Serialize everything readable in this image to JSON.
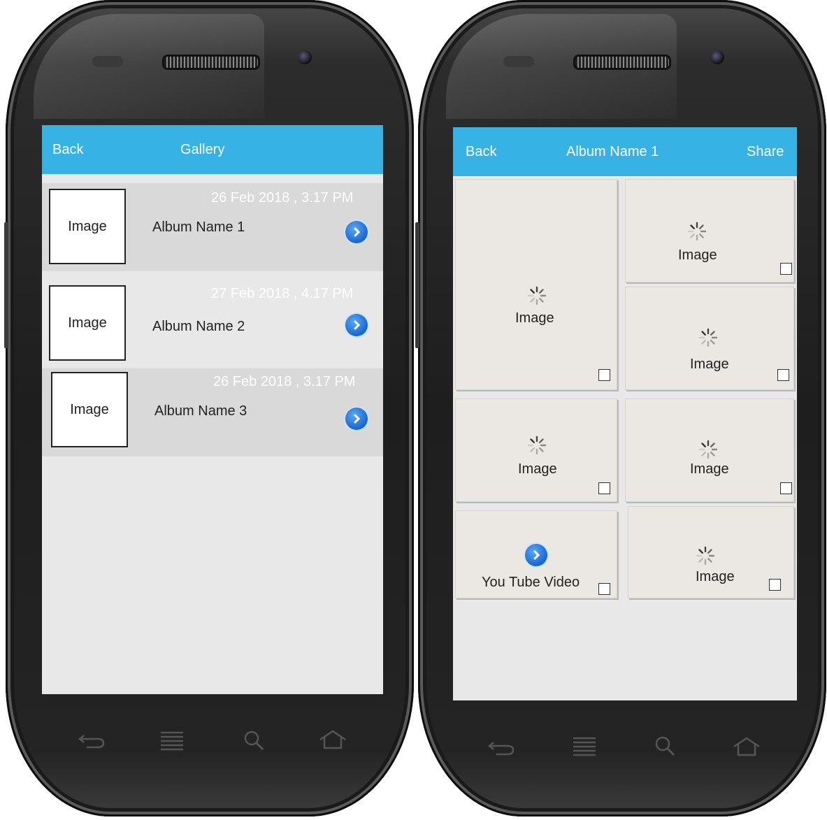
{
  "left_screen": {
    "header": {
      "back_label": "Back",
      "title": "Gallery"
    },
    "albums": [
      {
        "thumb_label": "Image",
        "date": "26 Feb 2018 ,  3.17 PM",
        "name": "Album Name  1"
      },
      {
        "thumb_label": "Image",
        "date": "27 Feb 2018 ,  4.17 PM",
        "name": "Album Name  2"
      },
      {
        "thumb_label": "Image",
        "date": "26 Feb 2018 ,  3.17 PM",
        "name": "Album Name  3"
      }
    ]
  },
  "right_screen": {
    "header": {
      "back_label": "Back",
      "title": "Album  Name 1",
      "share_label": "Share"
    },
    "tiles": [
      {
        "label": "Image"
      },
      {
        "label": "Image"
      },
      {
        "label": "Image"
      },
      {
        "label": "Image"
      },
      {
        "label": "Image"
      },
      {
        "label": "You Tube Video"
      },
      {
        "label": "Image"
      }
    ]
  },
  "colors": {
    "app_bar": "#36b3e4",
    "accent_button": "#1766d4",
    "row_alt": "#d9d9d9"
  },
  "icons": {
    "nav_back": "back-icon",
    "nav_menu": "menu-icon",
    "nav_search": "search-icon",
    "nav_home": "home-icon",
    "row_go": "chevron-right-icon",
    "loading": "loading-spinner-icon"
  }
}
